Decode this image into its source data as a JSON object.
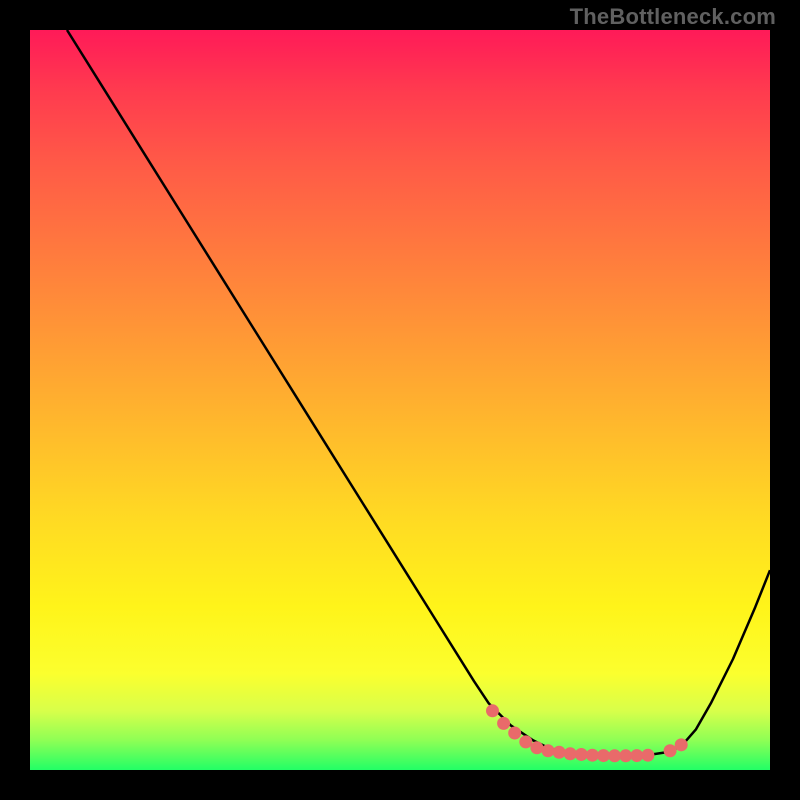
{
  "watermark": "TheBottleneck.com",
  "colors": {
    "frame": "#000000",
    "curve": "#000000",
    "dots": "#e96a6a"
  },
  "chart_data": {
    "type": "line",
    "title": "",
    "xlabel": "",
    "ylabel": "",
    "xlim": [
      0,
      100
    ],
    "ylim": [
      0,
      100
    ],
    "background_gradient": {
      "top": "#ff1a58",
      "middle": "#ffda23",
      "bottom": "#22ff66"
    },
    "series": [
      {
        "name": "bottleneck-curve",
        "description": "V-shaped curve; y is low (optimal) near x≈70-85 and rises steeply for low x and moderately for high x. Values estimated from pixel positions.",
        "x": [
          5,
          10,
          15,
          20,
          25,
          30,
          35,
          40,
          45,
          50,
          55,
          60,
          62,
          65,
          68,
          70,
          72,
          74,
          76,
          78,
          80,
          82,
          84,
          86,
          88,
          90,
          92,
          95,
          98,
          100
        ],
        "y": [
          100,
          92,
          84,
          76,
          68,
          60,
          52,
          44,
          36,
          28,
          20,
          12,
          9,
          6,
          4,
          3,
          2.5,
          2.2,
          2.0,
          1.9,
          1.9,
          2.0,
          2.1,
          2.4,
          3.2,
          5.5,
          9,
          15,
          22,
          27
        ]
      }
    ],
    "scatter": {
      "name": "optimal-dots",
      "description": "Cluster of points near the curve minimum (approximate, read from image).",
      "points": [
        {
          "x": 62.5,
          "y": 8.0
        },
        {
          "x": 64.0,
          "y": 6.3
        },
        {
          "x": 65.5,
          "y": 5.0
        },
        {
          "x": 67.0,
          "y": 3.8
        },
        {
          "x": 68.5,
          "y": 3.0
        },
        {
          "x": 70.0,
          "y": 2.6
        },
        {
          "x": 71.5,
          "y": 2.4
        },
        {
          "x": 73.0,
          "y": 2.2
        },
        {
          "x": 74.5,
          "y": 2.1
        },
        {
          "x": 76.0,
          "y": 2.0
        },
        {
          "x": 77.5,
          "y": 1.95
        },
        {
          "x": 79.0,
          "y": 1.92
        },
        {
          "x": 80.5,
          "y": 1.92
        },
        {
          "x": 82.0,
          "y": 1.95
        },
        {
          "x": 83.5,
          "y": 2.0
        },
        {
          "x": 86.5,
          "y": 2.6
        },
        {
          "x": 88.0,
          "y": 3.4
        }
      ]
    }
  }
}
